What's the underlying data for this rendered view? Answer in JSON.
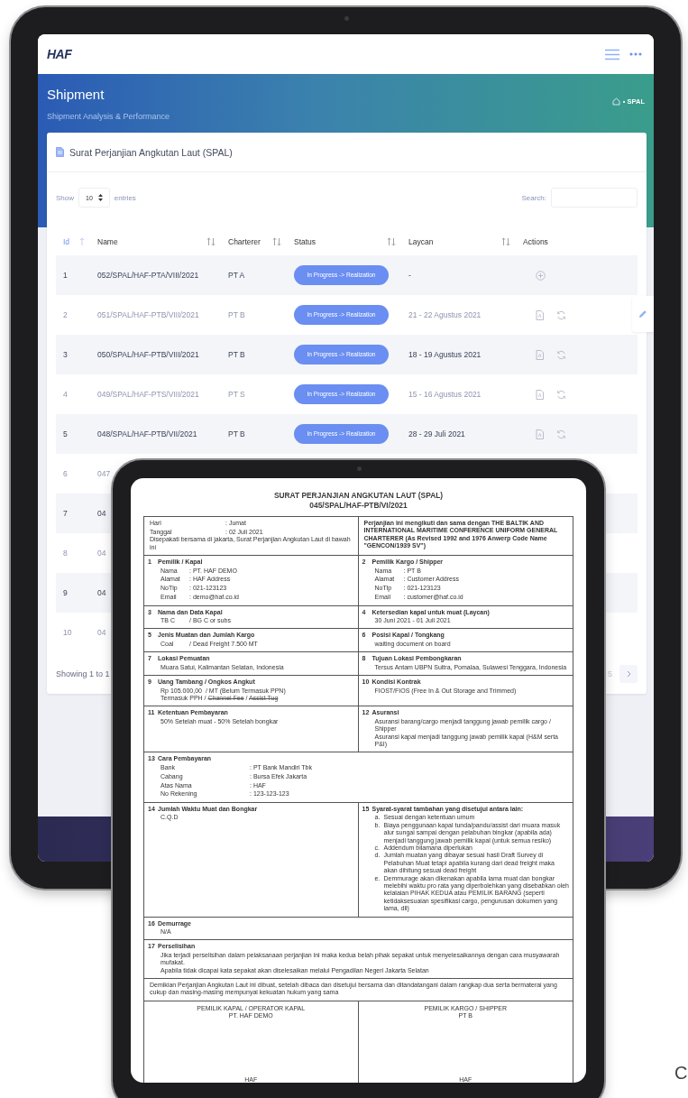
{
  "back_tablet": {
    "logo": "HAF",
    "page_title": "Shipment",
    "page_subtitle": "Shipment Analysis & Performance",
    "breadcrumb": "• SPAL",
    "card_title": "Surat Perjanjian Angkutan Laut (SPAL)",
    "length_control": {
      "before": "Show",
      "value": "10",
      "after": "entries"
    },
    "search": {
      "label": "Search:"
    },
    "columns": [
      {
        "label": "Id",
        "sortable": true,
        "sorted": true
      },
      {
        "label": "Name",
        "sortable": true,
        "sorted": false
      },
      {
        "label": "Charterer",
        "sortable": true,
        "sorted": false
      },
      {
        "label": "Status",
        "sortable": true,
        "sorted": false
      },
      {
        "label": "Laycan",
        "sortable": true,
        "sorted": false
      },
      {
        "label": "Actions",
        "sortable": false,
        "sorted": false
      }
    ],
    "rows": [
      {
        "id": "1",
        "name": "052/SPAL/HAF-PTA/VIII/2021",
        "charterer": "PT A",
        "status": "In Progress -> Realization",
        "laycan": "-",
        "actions": [
          {
            "kind": "add"
          }
        ]
      },
      {
        "id": "2",
        "name": "051/SPAL/HAF-PTB/VIII/2021",
        "charterer": "PT B",
        "status": "In Progress -> Realization",
        "laycan": "21 - 22 Agustus 2021",
        "actions": [
          {
            "kind": "pdf"
          },
          {
            "kind": "refresh"
          }
        ]
      },
      {
        "id": "3",
        "name": "050/SPAL/HAF-PTB/VIII/2021",
        "charterer": "PT B",
        "status": "In Progress -> Realization",
        "laycan": "18 - 19 Agustus 2021",
        "actions": [
          {
            "kind": "pdf"
          },
          {
            "kind": "refresh"
          }
        ]
      },
      {
        "id": "4",
        "name": "049/SPAL/HAF-PTS/VIII/2021",
        "charterer": "PT S",
        "status": "In Progress -> Realization",
        "laycan": "15 - 16 Agustus 2021",
        "actions": [
          {
            "kind": "pdf"
          },
          {
            "kind": "refresh"
          }
        ]
      },
      {
        "id": "5",
        "name": "048/SPAL/HAF-PTB/VII/2021",
        "charterer": "PT B",
        "status": "In Progress -> Realization",
        "laycan": "28 - 29 Juli 2021",
        "actions": [
          {
            "kind": "pdf"
          },
          {
            "kind": "refresh"
          }
        ]
      },
      {
        "id": "6",
        "name": "047"
      },
      {
        "id": "7",
        "name": "04"
      },
      {
        "id": "8",
        "name": "04"
      },
      {
        "id": "9",
        "name": "04"
      },
      {
        "id": "10",
        "name": "04"
      }
    ],
    "info": "Showing 1 to 1",
    "pages": [
      "5"
    ]
  },
  "document": {
    "title": "SURAT PERJANJIAN ANGKUTAN LAUT (SPAL)",
    "number": "045/SPAL/HAF-PTB/VI/2021",
    "rows": [
      {
        "kind": "split",
        "cells": [
          {
            "fields": [
              {
                "label": "Hari",
                "value": ": Jumat"
              },
              {
                "label": "Tanggal",
                "value": ": 02 Juli 2021"
              }
            ],
            "lines": [
              "Disepakati bersama di jakarta, Surat Perjanjian Angkutan Laut di bawah ini"
            ]
          },
          {
            "bold": true,
            "lines": [
              "Perjanjian ini mengikuti dan sama dengan THE BALTIK AND INTERNATIONAL MARITIME CONFERENCE UNIFORM GENERAL CHARTERER (As Revised 1992 and 1976 Anwerp Code Name \"GENCON/1939 SV\")"
            ]
          }
        ]
      },
      {
        "kind": "split",
        "cells": [
          {
            "number": "1",
            "title": "Pemilik / Kapal",
            "fields": [
              {
                "label": "Nama",
                "value": ": PT. HAF DEMO"
              },
              {
                "label": "Alamat",
                "value": ": HAF Address"
              },
              {
                "label": "NoTlp",
                "value": ": 021-123123"
              },
              {
                "label": "Email",
                "value": ": demo@haf.co.id"
              }
            ]
          },
          {
            "number": "2",
            "title": "Pemilik Kargo / Shipper",
            "fields": [
              {
                "label": "Nama",
                "value": ": PT B"
              },
              {
                "label": "Alamat",
                "value": ": Customer Address"
              },
              {
                "label": "NoTlp",
                "value": ": 021-123123"
              },
              {
                "label": "Email",
                "value": ": customer@haf.co.id"
              }
            ]
          }
        ]
      },
      {
        "kind": "split",
        "cells": [
          {
            "number": "3",
            "title": "Nama dan Data Kapal",
            "fields": [
              {
                "label": "TB C",
                "value": "/ BG C or subs"
              }
            ]
          },
          {
            "number": "4",
            "title": "Ketersedian kapal untuk muat (Laycan)",
            "lines": [
              "30 Juni 2021 - 01 Juli 2021"
            ]
          }
        ]
      },
      {
        "kind": "split",
        "cells": [
          {
            "number": "5",
            "title": "Jenis Muatan dan Jumlah Kargo",
            "fields": [
              {
                "label": "Coal",
                "value": "/ Dead Freight 7.500 MT"
              }
            ]
          },
          {
            "number": "6",
            "title": "Posisi Kapal / Tongkang",
            "lines": [
              "waiting document on board"
            ]
          }
        ]
      },
      {
        "kind": "split",
        "cells": [
          {
            "number": "7",
            "title": "Lokasi Pemuatan",
            "lines": [
              "Muara Satui, Kalimantan Selatan, Indonesia"
            ]
          },
          {
            "number": "8",
            "title": "Tujuan Lokasi Pembongkaran",
            "lines": [
              "Tersus Antam UBPN Sultra, Pomalaa, Sulawesi Tenggara, Indonesia"
            ]
          }
        ]
      },
      {
        "kind": "split",
        "cells": [
          {
            "number": "9",
            "title": "Uang Tambang / Ongkos Angkut",
            "fields": [
              {
                "label": "Rp 105.000,00",
                "value": "/ MT (Belum Termasuk PPN)"
              }
            ],
            "lines": [
              {
                "segments": [
                  {
                    "text": "Termasuk PPH / ",
                    "struck": false
                  },
                  {
                    "text": "Channel Fee",
                    "struck": true
                  },
                  {
                    "text": " / ",
                    "struck": false
                  },
                  {
                    "text": "Assist Tug",
                    "struck": true
                  }
                ]
              }
            ]
          },
          {
            "number": "10",
            "title": "Kondisi Kontrak",
            "lines": [
              "FIOST/FIOS (Free In & Out Storage and Trimmed)"
            ]
          }
        ]
      },
      {
        "kind": "split",
        "cells": [
          {
            "number": "11",
            "title": "Ketentuan Pembayaran",
            "lines": [
              "50% Setelah muat - 50% Setelah bongkar"
            ]
          },
          {
            "number": "12",
            "title": "Asuransi",
            "lines": [
              "Asuransi barang/cargo menjadi tanggung jawab pemilik cargo / Shipper",
              "Asuransi kapal menjadi tanggung jawab pemilik kapal (H&M serta P&I)"
            ]
          }
        ]
      },
      {
        "kind": "wide",
        "cells": [
          {
            "number": "13",
            "title": "Cara Pembayaran",
            "fields": [
              {
                "label": "Bank",
                "value": ": PT Bank Mandiri Tbk"
              },
              {
                "label": "Cabang",
                "value": ": Bursa Efek Jakarta"
              },
              {
                "label": "Atas Nama",
                "value": ": HAF"
              },
              {
                "label": "No Rekening",
                "value": ": 123-123-123"
              }
            ]
          }
        ]
      },
      {
        "kind": "split",
        "cells": [
          {
            "number": "14",
            "title": "Jumlah Waktu Muat dan Bongkar",
            "lines": [
              "C.Q.D"
            ]
          },
          {
            "number": "15",
            "title": "Syarat-syarat tambahan yang disetujui antara lain:",
            "items": [
              {
                "marker": "a.",
                "text": "Sesuai dengan ketentuan umum"
              },
              {
                "marker": "b.",
                "text": "Biaya penggunaan kapal tunda/pandu/assist dari muara masuk alur sungai sampai dengan pelabuhan bingkar (apabila ada) menjadi tanggung jawab pemilik kapal (untuk semua resiko)"
              },
              {
                "marker": "c.",
                "text": "Addendum bilamana diperlukan"
              },
              {
                "marker": "d.",
                "text": "Jumlah muatan yang dibayar sesuai hasil Draft Survey di Pelabuhan Muat tetapi apabila kurang dari dead freight maka akan dihitung sesuai dead freight"
              },
              {
                "marker": "e.",
                "text": "Demmurage akan dikenakan apabila lama muat dan bongkar melebihi waktu pro rata yang diperbolehkan yang disebabkan oleh kelalaian PIHAK KEDUA atau PEMILIK BARANG (seperti ketidaksesuaian spesifikasi cargo, pengurusan dokumen yang lama, dll)"
              }
            ]
          }
        ]
      },
      {
        "kind": "wide",
        "cells": [
          {
            "number": "16",
            "title": "Demurrage",
            "lines": [
              "N/A"
            ]
          }
        ]
      },
      {
        "kind": "wide",
        "cells": [
          {
            "number": "17",
            "title": "Perselisihan",
            "lines": [
              "Jika terjadi perselisihan dalam pelaksanaan perjanjian ini maka kedua belah pihak sepakat untuk menyelesaikannya dengan cara musyawarah mufakat.",
              "Apabila tidak dicapai kata sepakat akan diselesaikan melalui Pengadilan Negeri Jakarta Selatan"
            ]
          }
        ]
      },
      {
        "kind": "wide",
        "cells": [
          {
            "lines": [
              "Demikian Perjanjian Angkutan Laut ini dibuat, setelah dibaca dan disetujui bersama dan ditandatangani dalam rangkap dua serta bermaterai yang cukup dan masing-masing mempunyai kekuatan hukum yang sama"
            ]
          }
        ]
      },
      {
        "kind": "signature",
        "cells": [
          {
            "lines": [
              "PEMILIK KAPAL / OPERATOR KAPAL",
              "PT. HAF DEMO"
            ],
            "signer": "HAF"
          },
          {
            "lines": [
              "PEMILIK KARGO / SHIPPER",
              "PT B"
            ],
            "signer": "HAF"
          }
        ]
      }
    ]
  },
  "edge_text": "C"
}
